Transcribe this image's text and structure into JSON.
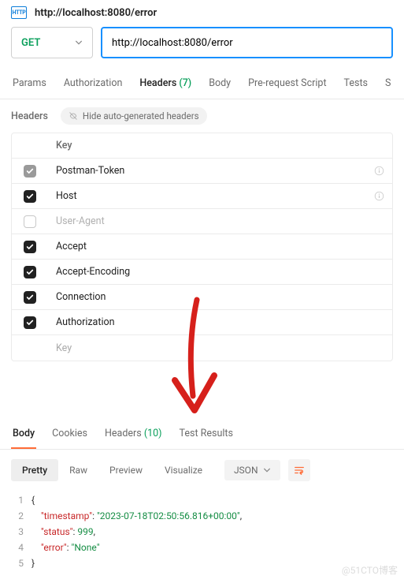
{
  "title": "http://localhost:8080/error",
  "request": {
    "method": "GET",
    "url": "http://localhost:8080/error"
  },
  "tabs": {
    "params": "Params",
    "auth": "Authorization",
    "headers": "Headers",
    "headers_count": "(7)",
    "body": "Body",
    "prereq": "Pre-request Script",
    "tests": "Tests",
    "settings_letter": "S"
  },
  "headers_section": {
    "label": "Headers",
    "hide_btn": "Hide auto-generated headers",
    "key_header": "Key",
    "key_placeholder": "Key",
    "rows": [
      {
        "key": "Postman-Token",
        "state": "partial"
      },
      {
        "key": "Host",
        "state": "on"
      },
      {
        "key": "User-Agent",
        "state": "empty"
      },
      {
        "key": "Accept",
        "state": "on"
      },
      {
        "key": "Accept-Encoding",
        "state": "on"
      },
      {
        "key": "Connection",
        "state": "on"
      },
      {
        "key": "Authorization",
        "state": "on"
      }
    ]
  },
  "response_tabs": {
    "body": "Body",
    "cookies": "Cookies",
    "headers": "Headers",
    "headers_count": "(10)",
    "test_results": "Test Results"
  },
  "view": {
    "pretty": "Pretty",
    "raw": "Raw",
    "preview": "Preview",
    "visualize": "Visualize",
    "format": "JSON"
  },
  "json_body": {
    "timestamp_key": "\"timestamp\"",
    "timestamp_val": "\"2023-07-18T02:50:56.816+00:00\"",
    "status_key": "\"status\"",
    "status_val": "999",
    "error_key": "\"error\"",
    "error_val": "\"None\""
  },
  "watermark": "@51CTO博客"
}
